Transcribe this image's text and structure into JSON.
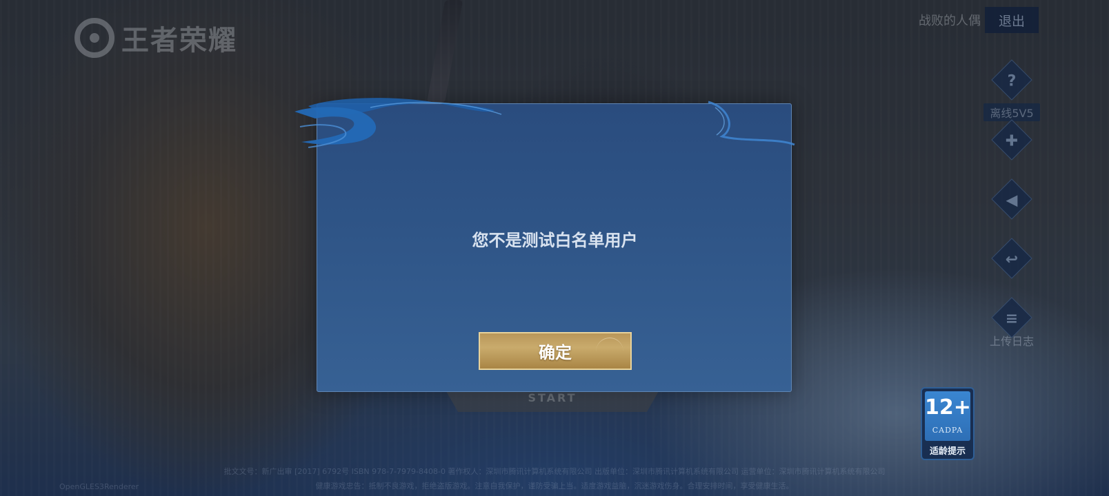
{
  "app": {
    "logo_text": "王者荣耀"
  },
  "top_bar": {
    "account_name": "战败的人偶",
    "exit_label": "退出"
  },
  "side_menu": {
    "items": [
      {
        "icon": "question-icon",
        "glyph": "?",
        "label": "离线5V5"
      },
      {
        "icon": "gamepad-icon",
        "glyph": "✚",
        "label": ""
      },
      {
        "icon": "speaker-icon",
        "glyph": "◀",
        "label": ""
      },
      {
        "icon": "switch-account-icon",
        "glyph": "↩",
        "label": ""
      },
      {
        "icon": "clipboard-icon",
        "glyph": "≡",
        "label": "上传日志"
      }
    ]
  },
  "start_button": {
    "label": "START"
  },
  "age_rating": {
    "number": "12+",
    "org": "CADPA",
    "hint": "适龄提示"
  },
  "footer": {
    "line1": "批文文号：新广出审 [2017] 6792号  ISBN 978-7-7979-8408-0  著作权人：深圳市腾讯计算机系统有限公司  出版单位：深圳市腾讯计算机系统有限公司  运营单位：深圳市腾讯计算机系统有限公司",
    "line2": "健康游戏忠告：抵制不良游戏，拒绝盗版游戏。注意自我保护，谨防受骗上当。适度游戏益脑，沉迷游戏伤身。合理安排时间，享受健康生活。",
    "engine": "OpenGLES3Renderer"
  },
  "dialog": {
    "message": "您不是测试白名单用户",
    "confirm_label": "确定"
  },
  "colors": {
    "modal_top": "#2a4c7e",
    "modal_bottom": "#376194",
    "modal_border": "#5f86b5",
    "confirm_gold": "#c9ab6c",
    "swirl_blue": "#1f5fa8"
  }
}
